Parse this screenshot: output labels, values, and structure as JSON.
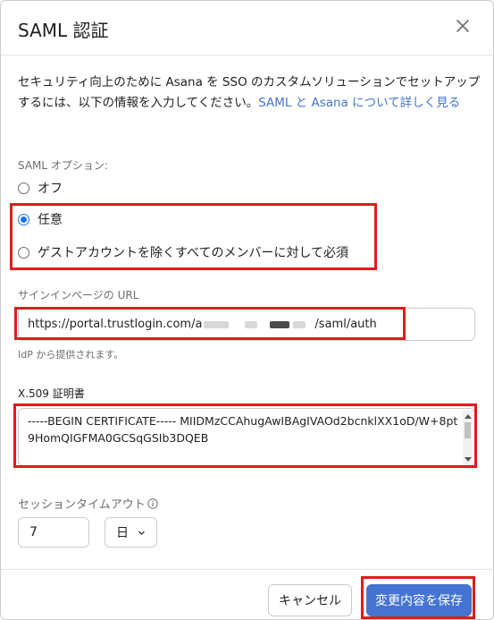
{
  "dialog": {
    "title": "SAML 認証",
    "close_icon": "close-icon"
  },
  "intro": {
    "text": "セキュリティ向上のために Asana を SSO のカスタムソリューションでセットアップするには、以下の情報を入力してください。",
    "link": "SAML と Asana について詳しく見る"
  },
  "saml_options": {
    "label": "SAML オプション:",
    "options": [
      {
        "label": "オフ",
        "checked": false
      },
      {
        "label": "任意",
        "checked": true
      },
      {
        "label": "ゲストアカウントを除くすべてのメンバーに対して必須",
        "checked": false
      }
    ]
  },
  "signin_url": {
    "label": "サインインページの URL",
    "value_prefix": "https://portal.trustlogin.com/a",
    "value_suffix": "/saml/auth",
    "hint": "IdP から提供されます。"
  },
  "certificate": {
    "label": "X.509 証明書",
    "value": "-----BEGIN CERTIFICATE----- MIIDMzCCAhugAwIBAgIVAOd2bcnklXX1oD/W+8pt9HomQIGFMA0GCSqGSIb3DQEB"
  },
  "session": {
    "label": "セッションタイムアウト",
    "info_icon": "info-icon",
    "value": "7",
    "unit": "日"
  },
  "footer": {
    "cancel_label": "キャンセル",
    "save_label": "変更内容を保存"
  },
  "colors": {
    "accent": "#4573d2",
    "radio_selected": "#1a73e8",
    "highlight": "#e31a1c"
  }
}
